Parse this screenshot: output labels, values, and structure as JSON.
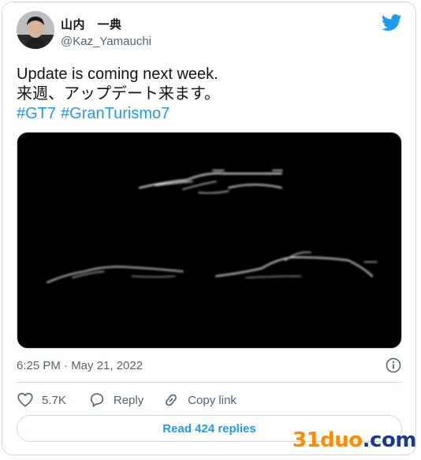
{
  "author": {
    "name": "山内　一典",
    "handle": "@Kaz_Yamauchi"
  },
  "icons": {
    "brand": "twitter-bird-icon",
    "info": "info-icon",
    "like": "heart-icon",
    "reply": "speech-bubble-icon",
    "copy": "link-icon"
  },
  "tweet": {
    "lines": [
      "Update is coming next week.",
      "来週、アップデート来ます。"
    ],
    "hashtags": [
      "#GT7",
      "#GranTurismo7"
    ]
  },
  "meta": {
    "timestamp": "6:25 PM · May 21, 2022"
  },
  "actions": {
    "likes": "5.7K",
    "reply_label": "Reply",
    "copy_label": "Copy link"
  },
  "read_replies_label": "Read 424 replies",
  "watermark": {
    "part1": "31duo",
    "part2": ".com"
  },
  "colors": {
    "accent": "#1d9bf0",
    "secondary_text": "#536471",
    "border": "#cfd9de",
    "watermark_orange": "#ff8a00",
    "watermark_blue": "#1b3a8f"
  }
}
